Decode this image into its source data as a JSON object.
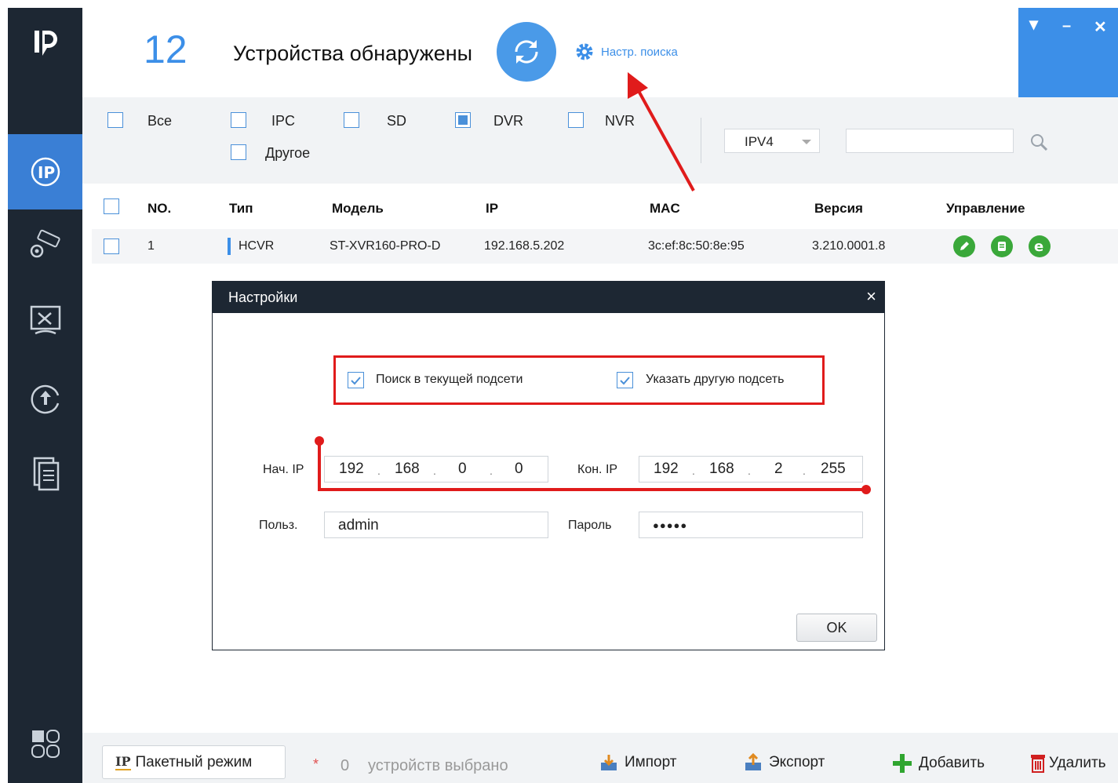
{
  "header": {
    "count": "12",
    "title": "Устройства обнаружены",
    "search_settings_label": "Настр. поиска"
  },
  "window_controls": [
    "▾",
    "–",
    "✕"
  ],
  "sidebar": {
    "logo": "IP",
    "items": [
      {
        "icon": "ip-search-icon",
        "active": true
      },
      {
        "icon": "camera-settings-icon",
        "active": false
      },
      {
        "icon": "tools-icon",
        "active": false
      },
      {
        "icon": "upgrade-icon",
        "active": false
      },
      {
        "icon": "document-icon",
        "active": false
      },
      {
        "icon": "apps-icon",
        "active": false
      }
    ]
  },
  "filters": {
    "all": "Все",
    "ipc": "IPC",
    "sd": "SD",
    "dvr": "DVR",
    "nvr": "NVR",
    "other": "Другое",
    "dvr_checked": true,
    "ip_version": "IPV4",
    "search_value": ""
  },
  "table": {
    "headers": {
      "no": "NO.",
      "type": "Тип",
      "model": "Модель",
      "ip": "IP",
      "mac": "MAC",
      "version": "Версия",
      "control": "Управление"
    },
    "rows": [
      {
        "no": "1",
        "type": "HCVR",
        "model": "ST-XVR160-PRO-D",
        "ip": "192.168.5.202",
        "mac": "3c:ef:8c:50:8e:95",
        "version": "3.210.0001.8"
      }
    ]
  },
  "dialog": {
    "title": "Настройки",
    "close": "×",
    "search_current_subnet": "Поиск в текущей подсети",
    "specify_other_subnet": "Указать другую подсеть",
    "start_ip_label": "Нач. IP",
    "start_ip": [
      "192",
      "168",
      "0",
      "0"
    ],
    "end_ip_label": "Кон. IP",
    "end_ip": [
      "192",
      "168",
      "2",
      "255"
    ],
    "ip_dot": ".",
    "user_label": "Польз.",
    "user_value": "admin",
    "password_label": "Пароль",
    "password_value": "●●●●●",
    "ok_label": "OK"
  },
  "bottom": {
    "batch_label": "Пакетный режим",
    "batch_icon_text": "IP",
    "star": "*",
    "selected_count": "0",
    "selected_label": "устройств выбрано",
    "import_label": "Импорт",
    "export_label": "Экспорт",
    "add_label": "Добавить",
    "delete_label": "Удалить"
  },
  "colors": {
    "sidebar": "#1d2733",
    "accent": "#3c8fe8",
    "annotation": "#e01b1b",
    "control_green": "#3aa83a"
  }
}
